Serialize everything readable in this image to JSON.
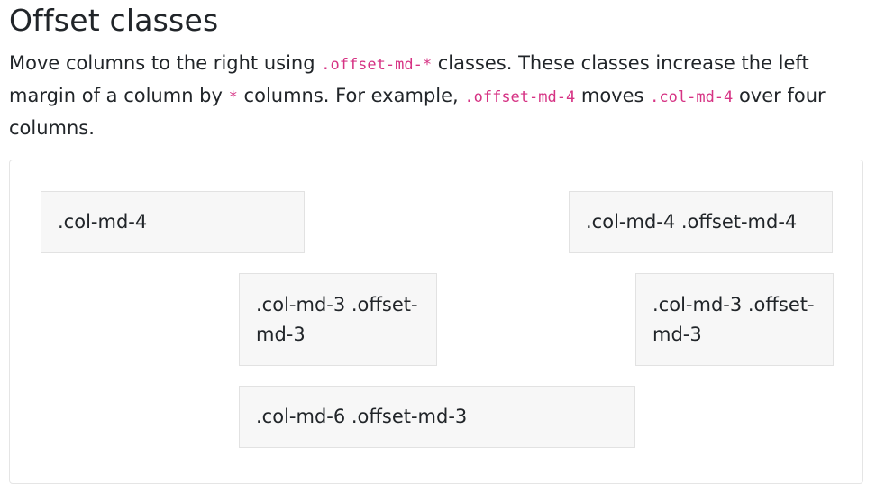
{
  "heading": {
    "title": "Offset classes"
  },
  "description": {
    "part1": "Move columns to the right using ",
    "code1": ".offset-md-*",
    "part2": " classes. These classes increase the left margin of a column by ",
    "code2": "*",
    "part3": " columns. For example, ",
    "code3": ".offset-md-4",
    "part4": " moves ",
    "code4": ".col-md-4",
    "part5": " over four columns."
  },
  "grid": {
    "row1": {
      "col1": ".col-md-4",
      "col2": ".col-md-4 .offset-md-4"
    },
    "row2": {
      "col1": ".col-md-3 .offset-md-3",
      "col2": ".col-md-3 .offset-md-3"
    },
    "row3": {
      "col1": ".col-md-6 .offset-md-3"
    }
  },
  "colors": {
    "code": "#d63384",
    "column_bg": "#f7f7f7",
    "column_border": "#e2e2e2",
    "panel_border": "#e5e5e5"
  }
}
